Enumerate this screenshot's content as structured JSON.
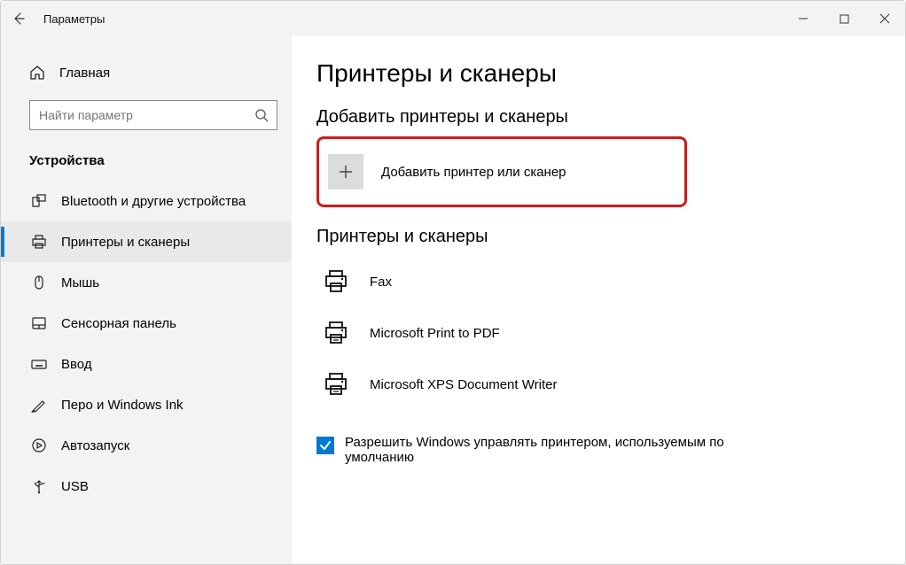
{
  "window": {
    "title": "Параметры"
  },
  "sidebar": {
    "home_label": "Главная",
    "search_placeholder": "Найти параметр",
    "category": "Устройства",
    "items": [
      {
        "label": "Bluetooth и другие устройства"
      },
      {
        "label": "Принтеры и сканеры"
      },
      {
        "label": "Мышь"
      },
      {
        "label": "Сенсорная панель"
      },
      {
        "label": "Ввод"
      },
      {
        "label": "Перо и Windows Ink"
      },
      {
        "label": "Автозапуск"
      },
      {
        "label": "USB"
      }
    ]
  },
  "main": {
    "page_title": "Принтеры и сканеры",
    "add_section": "Добавить принтеры и сканеры",
    "add_button": "Добавить принтер или сканер",
    "list_section": "Принтеры и сканеры",
    "devices": [
      {
        "label": "Fax"
      },
      {
        "label": "Microsoft Print to PDF"
      },
      {
        "label": "Microsoft XPS Document Writer"
      }
    ],
    "default_checkbox": "Разрешить Windows управлять принтером, используемым по умолчанию"
  }
}
